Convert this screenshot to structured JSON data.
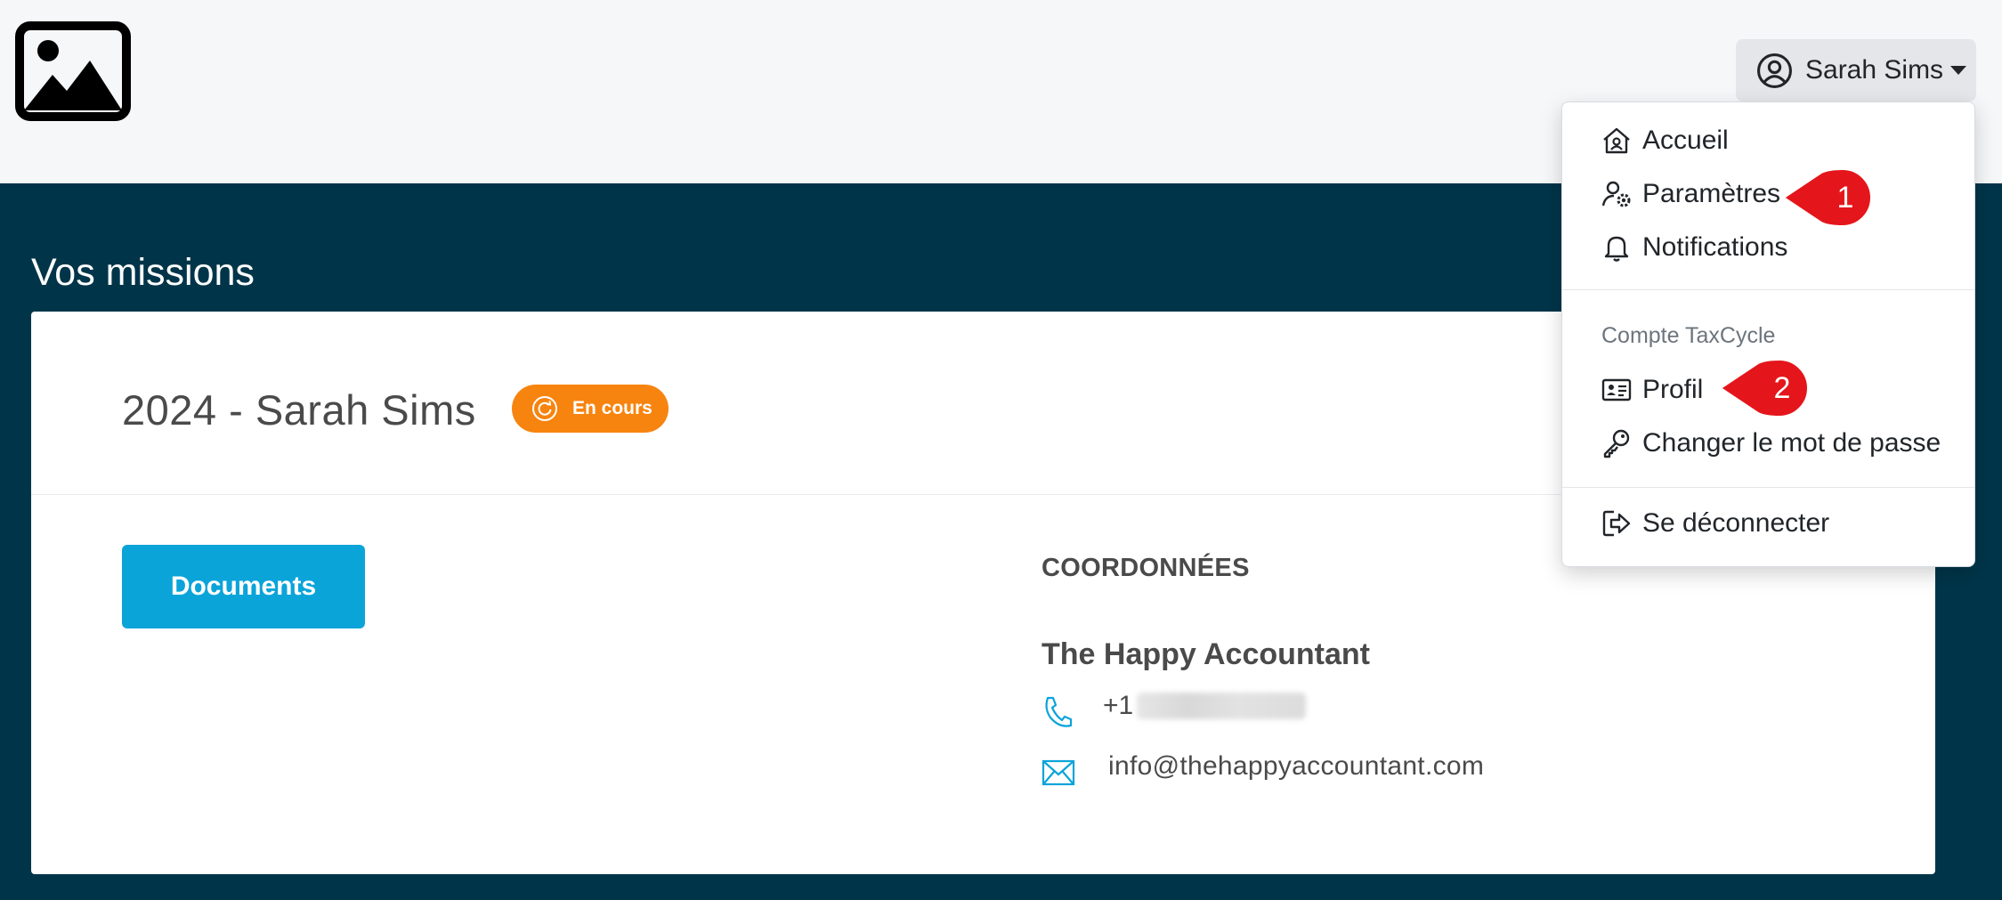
{
  "header": {
    "logo_icon": "image-placeholder-icon",
    "user_menu": {
      "name": "Sarah Sims",
      "icon": "user-circle-icon"
    }
  },
  "page": {
    "title": "Vos missions"
  },
  "mission": {
    "name": "2024 - Sarah Sims",
    "status": {
      "label": "En cours",
      "color": "#f7840f",
      "icon": "refresh-icon"
    },
    "documents_button": "Documents",
    "contact": {
      "heading": "COORDONNÉES",
      "company": "The Happy Accountant",
      "phone_prefix": "+1",
      "email": "info@thehappyaccountant.com"
    }
  },
  "dropdown": {
    "items": [
      {
        "label": "Accueil",
        "icon": "home-icon"
      },
      {
        "label": "Paramètres",
        "icon": "user-settings-icon"
      },
      {
        "label": "Notifications",
        "icon": "bell-icon"
      }
    ],
    "section_header": "Compte TaxCycle",
    "account_items": [
      {
        "label": "Profil",
        "icon": "id-card-icon"
      },
      {
        "label": "Changer le mot de passe",
        "icon": "key-icon"
      }
    ],
    "logout": {
      "label": "Se déconnecter",
      "icon": "logout-icon"
    }
  },
  "annotations": [
    {
      "number": "1",
      "target": "Paramètres"
    },
    {
      "number": "2",
      "target": "Profil"
    }
  ],
  "colors": {
    "navy_background": "#003549",
    "accent_blue": "#0aa4d9",
    "status_orange": "#f7840f",
    "callout_red": "#e4161b"
  }
}
